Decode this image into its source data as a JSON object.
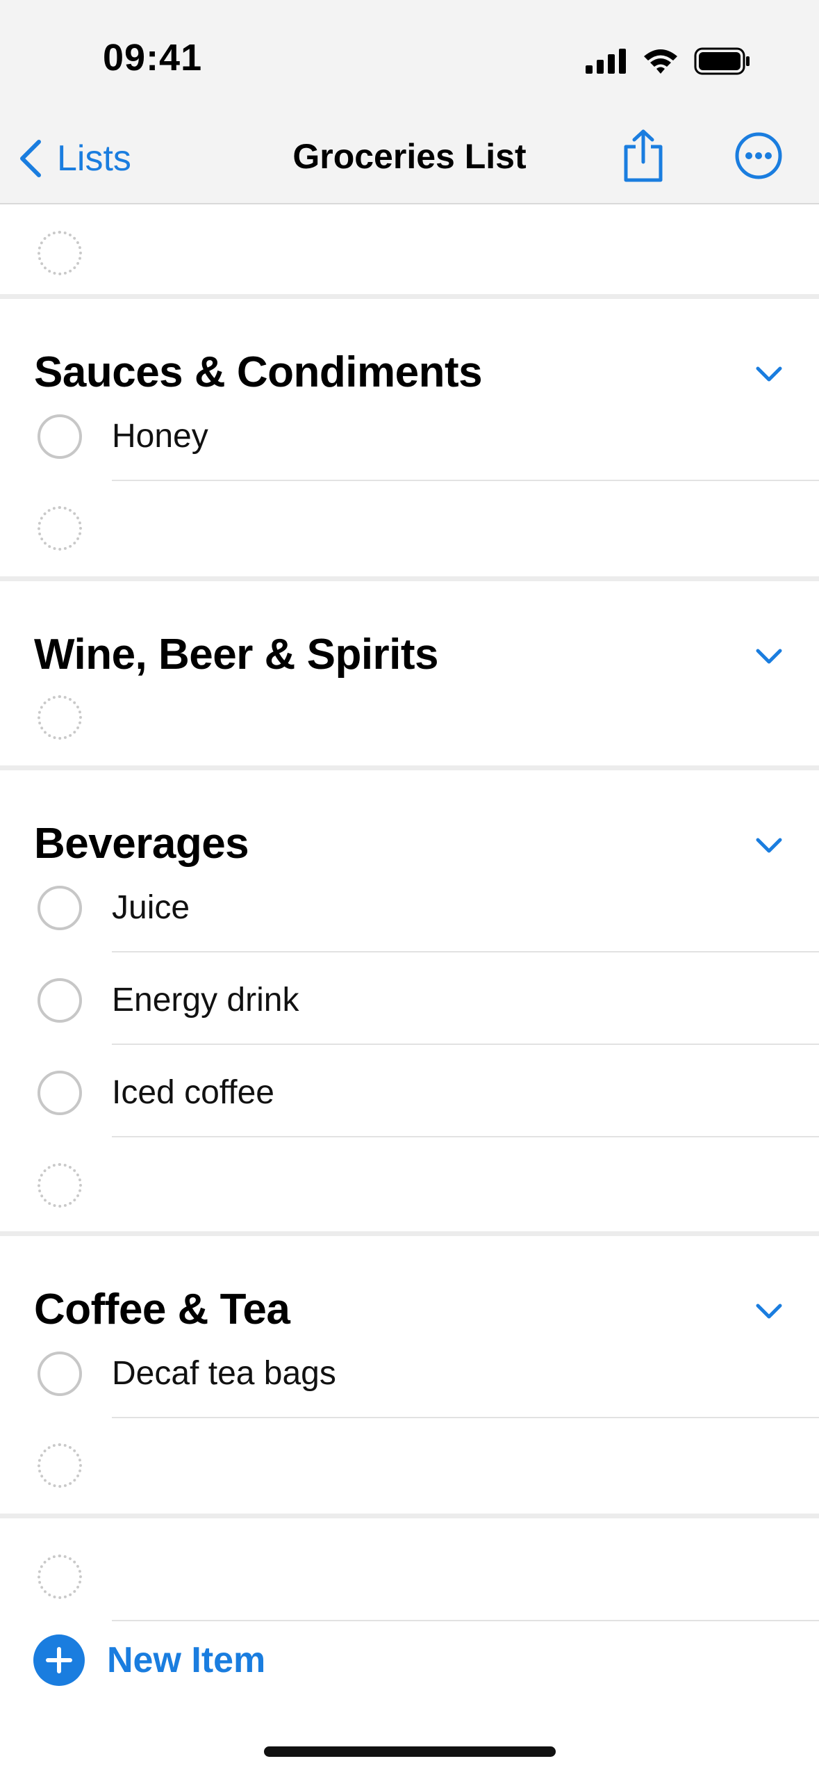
{
  "status_bar": {
    "time": "09:41"
  },
  "nav": {
    "back_label": "Lists",
    "title": "Groceries List"
  },
  "sections": [
    {
      "title": "Sauces & Condiments",
      "items": [
        "Honey"
      ]
    },
    {
      "title": "Wine, Beer & Spirits",
      "items": []
    },
    {
      "title": "Beverages",
      "items": [
        "Juice",
        "Energy drink",
        "Iced coffee"
      ]
    },
    {
      "title": "Coffee & Tea",
      "items": [
        "Decaf tea bags"
      ]
    }
  ],
  "footer": {
    "new_item_label": "New Item"
  },
  "colors": {
    "accent": "#1a7ddf",
    "checkbox_border": "#c7c7c7"
  },
  "icons": [
    "back-chevron-icon",
    "share-icon",
    "more-icon",
    "collapse-chevron-icon",
    "plus-icon",
    "signal-icon",
    "wifi-icon",
    "battery-icon"
  ]
}
